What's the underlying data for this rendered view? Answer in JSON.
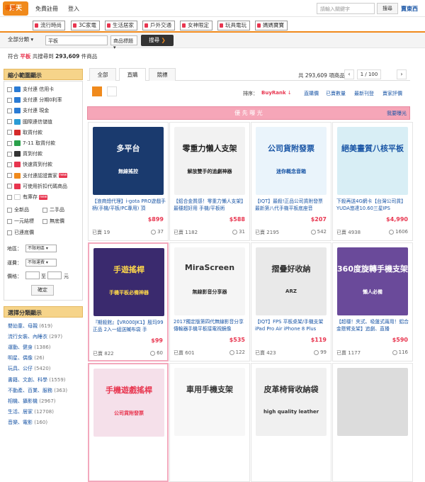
{
  "header": {
    "logo": "露天",
    "links": [
      "免費註冊",
      "登入"
    ],
    "search_placeholder": "請輸入關鍵字",
    "search_button": "搜尋",
    "right_link": "賣東西"
  },
  "nav": {
    "label": "導覽",
    "tabs": [
      "流行時尚",
      "3C家電",
      "生活居家",
      "戶外交通",
      "女神限定",
      "玩具電玩",
      "媽媽寶寶"
    ]
  },
  "search": {
    "category": "全部分類",
    "query": "平板",
    "option": "商品標題",
    "button": "搜尋"
  },
  "result": {
    "prefix": "符合",
    "keyword": "平板",
    "middle": "共搜尋到",
    "count": "293,609",
    "suffix": "件商品"
  },
  "sidebar": {
    "narrow_title": "縮小範圍顯示",
    "payments": [
      {
        "label": "支付連 信用卡",
        "color": "#2a7bd4",
        "is_new": false
      },
      {
        "label": "支付連 分期0利率",
        "color": "#2a7bd4",
        "is_new": false
      },
      {
        "label": "支付連 現金",
        "color": "#2a7bd4",
        "is_new": false
      },
      {
        "label": "國際連信儲值",
        "color": "#2a9bd4",
        "is_new": false
      },
      {
        "label": "取貨付款",
        "color": "#d42a2a",
        "is_new": false
      },
      {
        "label": "7-11 取貨付款",
        "color": "#2aa04a",
        "is_new": false
      },
      {
        "label": "貨到付款",
        "color": "#333333",
        "is_new": false
      },
      {
        "label": "快速貨到付款",
        "color": "#e8354f",
        "is_new": false
      },
      {
        "label": "支付連認證賣家",
        "color": "#f08a1c",
        "is_new": true
      },
      {
        "label": "可使用折扣代碼商品",
        "color": "#e8354f",
        "is_new": false
      },
      {
        "label": "有庫存",
        "color": "#ffffff",
        "is_new": true
      }
    ],
    "conditions": [
      [
        "全新品",
        "二手品"
      ],
      [
        "一元結標",
        "無底價"
      ],
      [
        "已連底價",
        ""
      ]
    ],
    "region_label": "地區：",
    "region_value": "不限地區",
    "shipping_label": "運費：",
    "shipping_value": "不限運費",
    "price_label": "價格：",
    "price_to": "至",
    "price_unit": "元",
    "ok_button": "確定",
    "category_title": "選擇分類顯示",
    "categories": [
      {
        "name": "嬰幼童、母親",
        "count": "(619)"
      },
      {
        "name": "流行女裝、內睡衣",
        "count": "(297)"
      },
      {
        "name": "運動、健身",
        "count": "(1386)"
      },
      {
        "name": "明星、偶像",
        "count": "(26)"
      },
      {
        "name": "玩具、公仔",
        "count": "(5420)"
      },
      {
        "name": "書籍、文創、科學",
        "count": "(1559)"
      },
      {
        "name": "不動產、百業、服務",
        "count": "(363)"
      },
      {
        "name": "相機、攝影機",
        "count": "(2967)"
      },
      {
        "name": "生活、居家",
        "count": "(12708)"
      },
      {
        "name": "音樂、電影",
        "count": "(160)"
      }
    ]
  },
  "tabs": [
    "全部",
    "直購",
    "競標"
  ],
  "tab_count": "共 293,609 項商品",
  "pagination": {
    "current": "1 / 100",
    "prev": "‹",
    "next": "›"
  },
  "sort": {
    "label": "排序：",
    "current": "BuyRank",
    "options": [
      "直購價",
      "已賣數量",
      "最新刊登",
      "賣家評價"
    ]
  },
  "priority": {
    "title": "優 先 曝 光",
    "link": "我要曝光"
  },
  "products": [
    {
      "title": "【浪商總代理】i-gota PRO遊戲手柄(手機/平板/PC專用) 頂",
      "price": "899",
      "sold_label": "已賣",
      "sold": "19",
      "likes": "37",
      "img_text": "多平台",
      "img_sub": "無線搖控",
      "bg": "#1a3a6e",
      "fg": "#ffffff",
      "highlight": false
    },
    {
      "title": "【鋁合金質感！零重力懶人支架】最穩超好用 手機/平板術",
      "price": "588",
      "sold_label": "已賣",
      "sold": "1182",
      "likes": "31",
      "img_text": "零重力懶人支架",
      "img_sub": "解放雙手的追劇神器",
      "bg": "#f2f2f2",
      "fg": "#222222",
      "highlight": false
    },
    {
      "title": "【IQT】最殺!正品公司貨附發票 最新第八代手機平板底座音",
      "price": "207",
      "sold_label": "已賣",
      "sold": "2195",
      "likes": "542",
      "img_text": "公司貨附發票",
      "img_sub": "迷你概念音箱",
      "bg": "#eaf4fb",
      "fg": "#1a56a6",
      "highlight": false
    },
    {
      "title": "下殺再送4G網卡【台灣公司貨】YUDA悠達10.60三星IPS",
      "price": "4,990",
      "sold_label": "已賣",
      "sold": "4938",
      "likes": "1606",
      "img_text": "絕美畫質八核平板",
      "img_sub": "",
      "bg": "#d8eef5",
      "fg": "#1a56a6",
      "highlight": false
    },
    {
      "title": "『期殺館』【VR000JK1】殷玛99 正品 2入一組送贓布袋 手",
      "price": "99",
      "sold_label": "已賣",
      "sold": "822",
      "likes": "60",
      "img_text": "手遊搖桿",
      "img_sub": "手機平板必備神器",
      "bg": "#3a2a6e",
      "fg": "#ffd84a",
      "highlight": true
    },
    {
      "title": "2017獨定版第四代無線影音分享傳輸器手機平板接電視鏡像",
      "price": "535",
      "sold_label": "已賣",
      "sold": "601",
      "likes": "122",
      "img_text": "MiraScreen",
      "img_sub": "無線影音分享器",
      "bg": "#f5f5f5",
      "fg": "#333333",
      "highlight": false
    },
    {
      "title": "【IQT】FPS 平板桌架/手機支架 iPad Pro Air iPhone 8 Plus",
      "price": "119",
      "sold_label": "已賣",
      "sold": "423",
      "likes": "99",
      "img_text": "摺疊好收納",
      "img_sub": "ARZ",
      "bg": "#e9e9e9",
      "fg": "#333333",
      "highlight": false
    },
    {
      "title": "【超穩！夾式、吸盤式兩用！鋁合金懸臂支架】追劇、直播",
      "price": "590",
      "sold_label": "已賣",
      "sold": "1177",
      "likes": "116",
      "img_text": "360度旋轉手機支架",
      "img_sub": "懶人必備",
      "bg": "#6a4a9a",
      "fg": "#ffffff",
      "highlight": false
    },
    {
      "title": "",
      "price": "",
      "sold_label": "",
      "sold": "",
      "likes": "",
      "img_text": "手機遊戲搖桿",
      "img_sub": "公司貨附發票",
      "bg": "#f5e0ea",
      "fg": "#e8354f",
      "highlight": true
    },
    {
      "title": "",
      "price": "",
      "sold_label": "",
      "sold": "",
      "likes": "",
      "img_text": "車用手機支架",
      "img_sub": "",
      "bg": "#f7f7f7",
      "fg": "#333333",
      "highlight": false
    },
    {
      "title": "",
      "price": "",
      "sold_label": "",
      "sold": "",
      "likes": "",
      "img_text": "皮革椅背收納袋",
      "img_sub": "high quality leather",
      "bg": "#f0f0f0",
      "fg": "#333333",
      "highlight": false
    },
    {
      "title": "",
      "price": "",
      "sold_label": "",
      "sold": "",
      "likes": "",
      "img_text": "",
      "img_sub": "",
      "bg": "#dcdcdc",
      "fg": "#333333",
      "highlight": false
    }
  ]
}
